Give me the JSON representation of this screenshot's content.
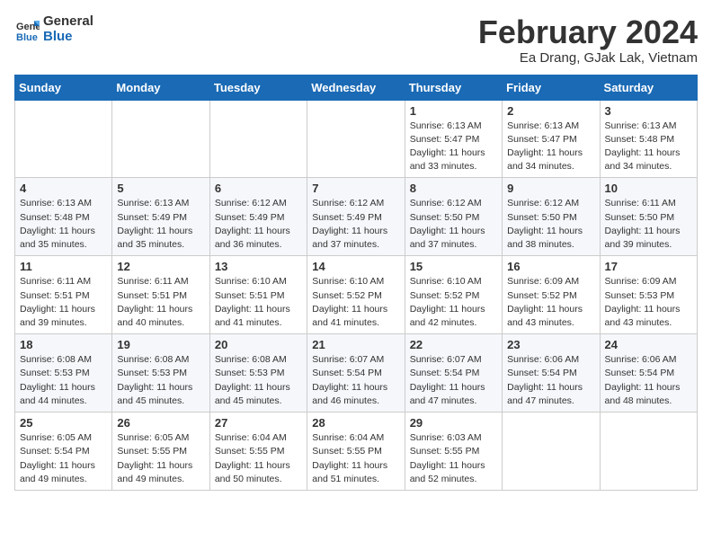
{
  "logo": {
    "line1": "General",
    "line2": "Blue"
  },
  "title": "February 2024",
  "location": "Ea Drang, GJak Lak, Vietnam",
  "days_header": [
    "Sunday",
    "Monday",
    "Tuesday",
    "Wednesday",
    "Thursday",
    "Friday",
    "Saturday"
  ],
  "weeks": [
    [
      {
        "day": "",
        "info": ""
      },
      {
        "day": "",
        "info": ""
      },
      {
        "day": "",
        "info": ""
      },
      {
        "day": "",
        "info": ""
      },
      {
        "day": "1",
        "info": "Sunrise: 6:13 AM\nSunset: 5:47 PM\nDaylight: 11 hours and 33 minutes."
      },
      {
        "day": "2",
        "info": "Sunrise: 6:13 AM\nSunset: 5:47 PM\nDaylight: 11 hours and 34 minutes."
      },
      {
        "day": "3",
        "info": "Sunrise: 6:13 AM\nSunset: 5:48 PM\nDaylight: 11 hours and 34 minutes."
      }
    ],
    [
      {
        "day": "4",
        "info": "Sunrise: 6:13 AM\nSunset: 5:48 PM\nDaylight: 11 hours and 35 minutes."
      },
      {
        "day": "5",
        "info": "Sunrise: 6:13 AM\nSunset: 5:49 PM\nDaylight: 11 hours and 35 minutes."
      },
      {
        "day": "6",
        "info": "Sunrise: 6:12 AM\nSunset: 5:49 PM\nDaylight: 11 hours and 36 minutes."
      },
      {
        "day": "7",
        "info": "Sunrise: 6:12 AM\nSunset: 5:49 PM\nDaylight: 11 hours and 37 minutes."
      },
      {
        "day": "8",
        "info": "Sunrise: 6:12 AM\nSunset: 5:50 PM\nDaylight: 11 hours and 37 minutes."
      },
      {
        "day": "9",
        "info": "Sunrise: 6:12 AM\nSunset: 5:50 PM\nDaylight: 11 hours and 38 minutes."
      },
      {
        "day": "10",
        "info": "Sunrise: 6:11 AM\nSunset: 5:50 PM\nDaylight: 11 hours and 39 minutes."
      }
    ],
    [
      {
        "day": "11",
        "info": "Sunrise: 6:11 AM\nSunset: 5:51 PM\nDaylight: 11 hours and 39 minutes."
      },
      {
        "day": "12",
        "info": "Sunrise: 6:11 AM\nSunset: 5:51 PM\nDaylight: 11 hours and 40 minutes."
      },
      {
        "day": "13",
        "info": "Sunrise: 6:10 AM\nSunset: 5:51 PM\nDaylight: 11 hours and 41 minutes."
      },
      {
        "day": "14",
        "info": "Sunrise: 6:10 AM\nSunset: 5:52 PM\nDaylight: 11 hours and 41 minutes."
      },
      {
        "day": "15",
        "info": "Sunrise: 6:10 AM\nSunset: 5:52 PM\nDaylight: 11 hours and 42 minutes."
      },
      {
        "day": "16",
        "info": "Sunrise: 6:09 AM\nSunset: 5:52 PM\nDaylight: 11 hours and 43 minutes."
      },
      {
        "day": "17",
        "info": "Sunrise: 6:09 AM\nSunset: 5:53 PM\nDaylight: 11 hours and 43 minutes."
      }
    ],
    [
      {
        "day": "18",
        "info": "Sunrise: 6:08 AM\nSunset: 5:53 PM\nDaylight: 11 hours and 44 minutes."
      },
      {
        "day": "19",
        "info": "Sunrise: 6:08 AM\nSunset: 5:53 PM\nDaylight: 11 hours and 45 minutes."
      },
      {
        "day": "20",
        "info": "Sunrise: 6:08 AM\nSunset: 5:53 PM\nDaylight: 11 hours and 45 minutes."
      },
      {
        "day": "21",
        "info": "Sunrise: 6:07 AM\nSunset: 5:54 PM\nDaylight: 11 hours and 46 minutes."
      },
      {
        "day": "22",
        "info": "Sunrise: 6:07 AM\nSunset: 5:54 PM\nDaylight: 11 hours and 47 minutes."
      },
      {
        "day": "23",
        "info": "Sunrise: 6:06 AM\nSunset: 5:54 PM\nDaylight: 11 hours and 47 minutes."
      },
      {
        "day": "24",
        "info": "Sunrise: 6:06 AM\nSunset: 5:54 PM\nDaylight: 11 hours and 48 minutes."
      }
    ],
    [
      {
        "day": "25",
        "info": "Sunrise: 6:05 AM\nSunset: 5:54 PM\nDaylight: 11 hours and 49 minutes."
      },
      {
        "day": "26",
        "info": "Sunrise: 6:05 AM\nSunset: 5:55 PM\nDaylight: 11 hours and 49 minutes."
      },
      {
        "day": "27",
        "info": "Sunrise: 6:04 AM\nSunset: 5:55 PM\nDaylight: 11 hours and 50 minutes."
      },
      {
        "day": "28",
        "info": "Sunrise: 6:04 AM\nSunset: 5:55 PM\nDaylight: 11 hours and 51 minutes."
      },
      {
        "day": "29",
        "info": "Sunrise: 6:03 AM\nSunset: 5:55 PM\nDaylight: 11 hours and 52 minutes."
      },
      {
        "day": "",
        "info": ""
      },
      {
        "day": "",
        "info": ""
      }
    ]
  ]
}
